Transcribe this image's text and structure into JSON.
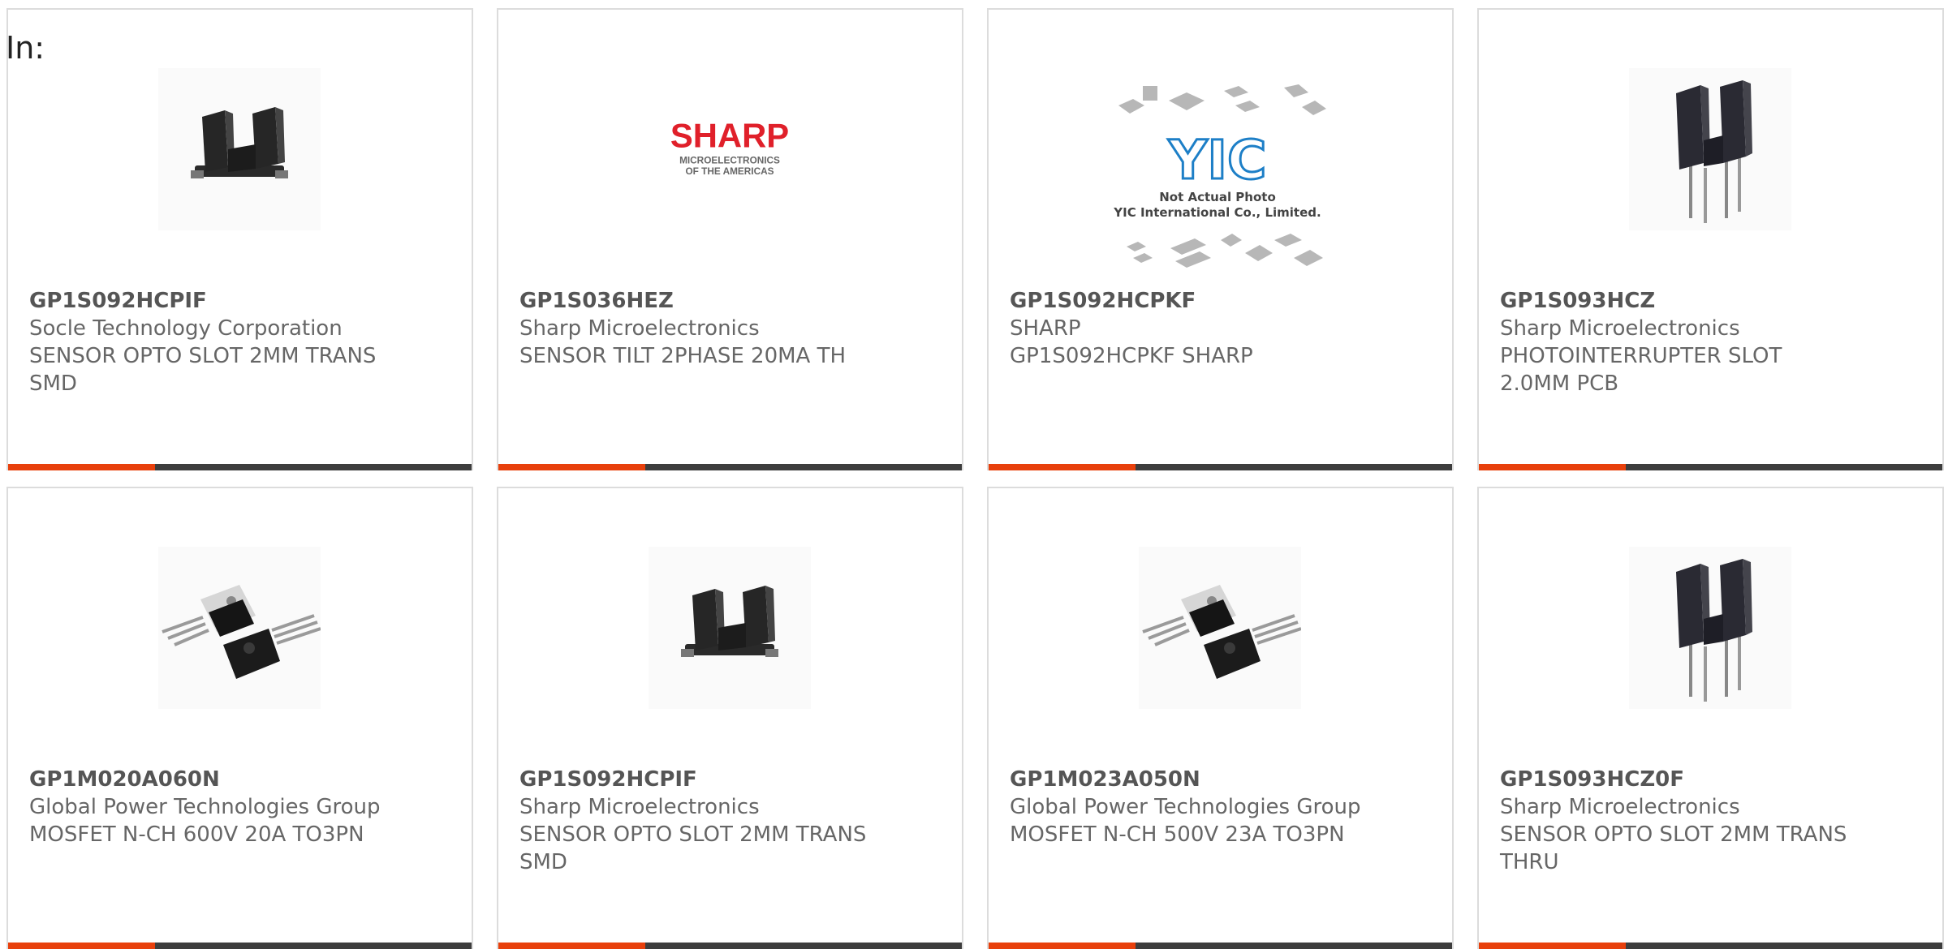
{
  "header": {
    "in_label": "In:"
  },
  "colors": {
    "accent": "#e8400c",
    "bar": "#3d3d3d",
    "border": "#dcdcdc",
    "text": "#666666"
  },
  "logos": {
    "sharp": {
      "brand": "SHARP",
      "line1": "MICROELECTRONICS",
      "line2": "OF THE AMERICAS"
    },
    "yic": {
      "mark": "YIC",
      "line1": "Not Actual Photo",
      "line2": "YIC International Co., Limited."
    }
  },
  "products": [
    {
      "part": "GP1S092HCPIF",
      "maker": "Socle Technology Corporation",
      "desc1": "SENSOR OPTO SLOT 2MM TRANS",
      "desc2": "SMD",
      "image": "photointerrupter-smd-icon"
    },
    {
      "part": "GP1S036HEZ",
      "maker": "Sharp Microelectronics",
      "desc1": "SENSOR TILT 2PHASE 20MA TH",
      "desc2": "",
      "image": "sharp-logo"
    },
    {
      "part": "GP1S092HCPKF",
      "maker": "SHARP",
      "desc1": "GP1S092HCPKF SHARP",
      "desc2": "",
      "image": "yic-placeholder"
    },
    {
      "part": "GP1S093HCZ",
      "maker": "Sharp Microelectronics",
      "desc1": "PHOTOINTERRUPTER SLOT",
      "desc2": "2.0MM PCB",
      "image": "photointerrupter-thru-icon"
    },
    {
      "part": "GP1M020A060N",
      "maker": "Global Power Technologies Group",
      "desc1": "MOSFET N-CH 600V 20A TO3PN",
      "desc2": "",
      "image": "to3p-mosfet-icon"
    },
    {
      "part": "GP1S092HCPIF",
      "maker": "Sharp Microelectronics",
      "desc1": "SENSOR OPTO SLOT 2MM TRANS",
      "desc2": "SMD",
      "image": "photointerrupter-smd-icon"
    },
    {
      "part": "GP1M023A050N",
      "maker": "Global Power Technologies Group",
      "desc1": "MOSFET N-CH 500V 23A TO3PN",
      "desc2": "",
      "image": "to3p-mosfet-icon"
    },
    {
      "part": "GP1S093HCZ0F",
      "maker": "Sharp Microelectronics",
      "desc1": "SENSOR OPTO SLOT 2MM TRANS",
      "desc2": "THRU",
      "image": "photointerrupter-thru-icon"
    }
  ]
}
